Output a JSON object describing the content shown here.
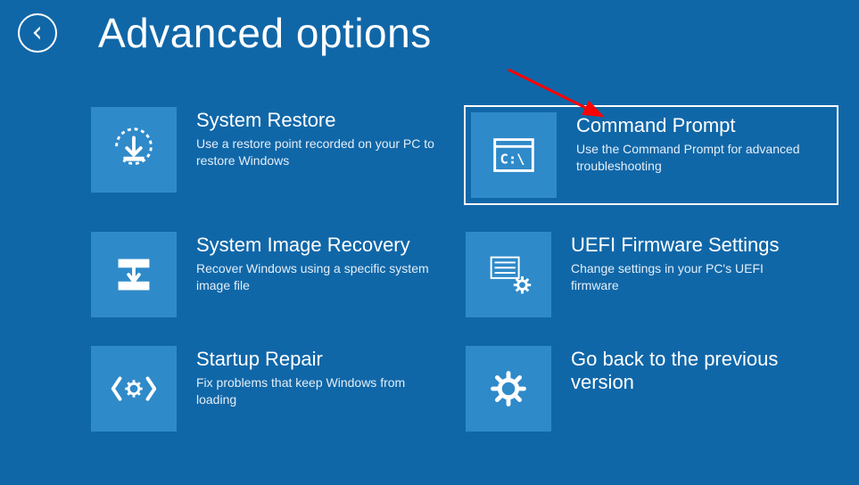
{
  "header": {
    "title": "Advanced options"
  },
  "tiles": [
    {
      "title": "System Restore",
      "desc": "Use a restore point recorded on your PC to restore Windows",
      "selected": false,
      "icon": "restore"
    },
    {
      "title": "Command Prompt",
      "desc": "Use the Command Prompt for advanced troubleshooting",
      "selected": true,
      "icon": "cmd"
    },
    {
      "title": "System Image Recovery",
      "desc": "Recover Windows using a specific system image file",
      "selected": false,
      "icon": "image-recovery"
    },
    {
      "title": "UEFI Firmware Settings",
      "desc": "Change settings in your PC's UEFI firmware",
      "selected": false,
      "icon": "uefi"
    },
    {
      "title": "Startup Repair",
      "desc": "Fix problems that keep Windows from loading",
      "selected": false,
      "icon": "startup-repair"
    },
    {
      "title": "Go back to the previous version",
      "desc": "",
      "selected": false,
      "icon": "go-back"
    }
  ],
  "annotation": {
    "arrow_color": "#ff0000"
  }
}
